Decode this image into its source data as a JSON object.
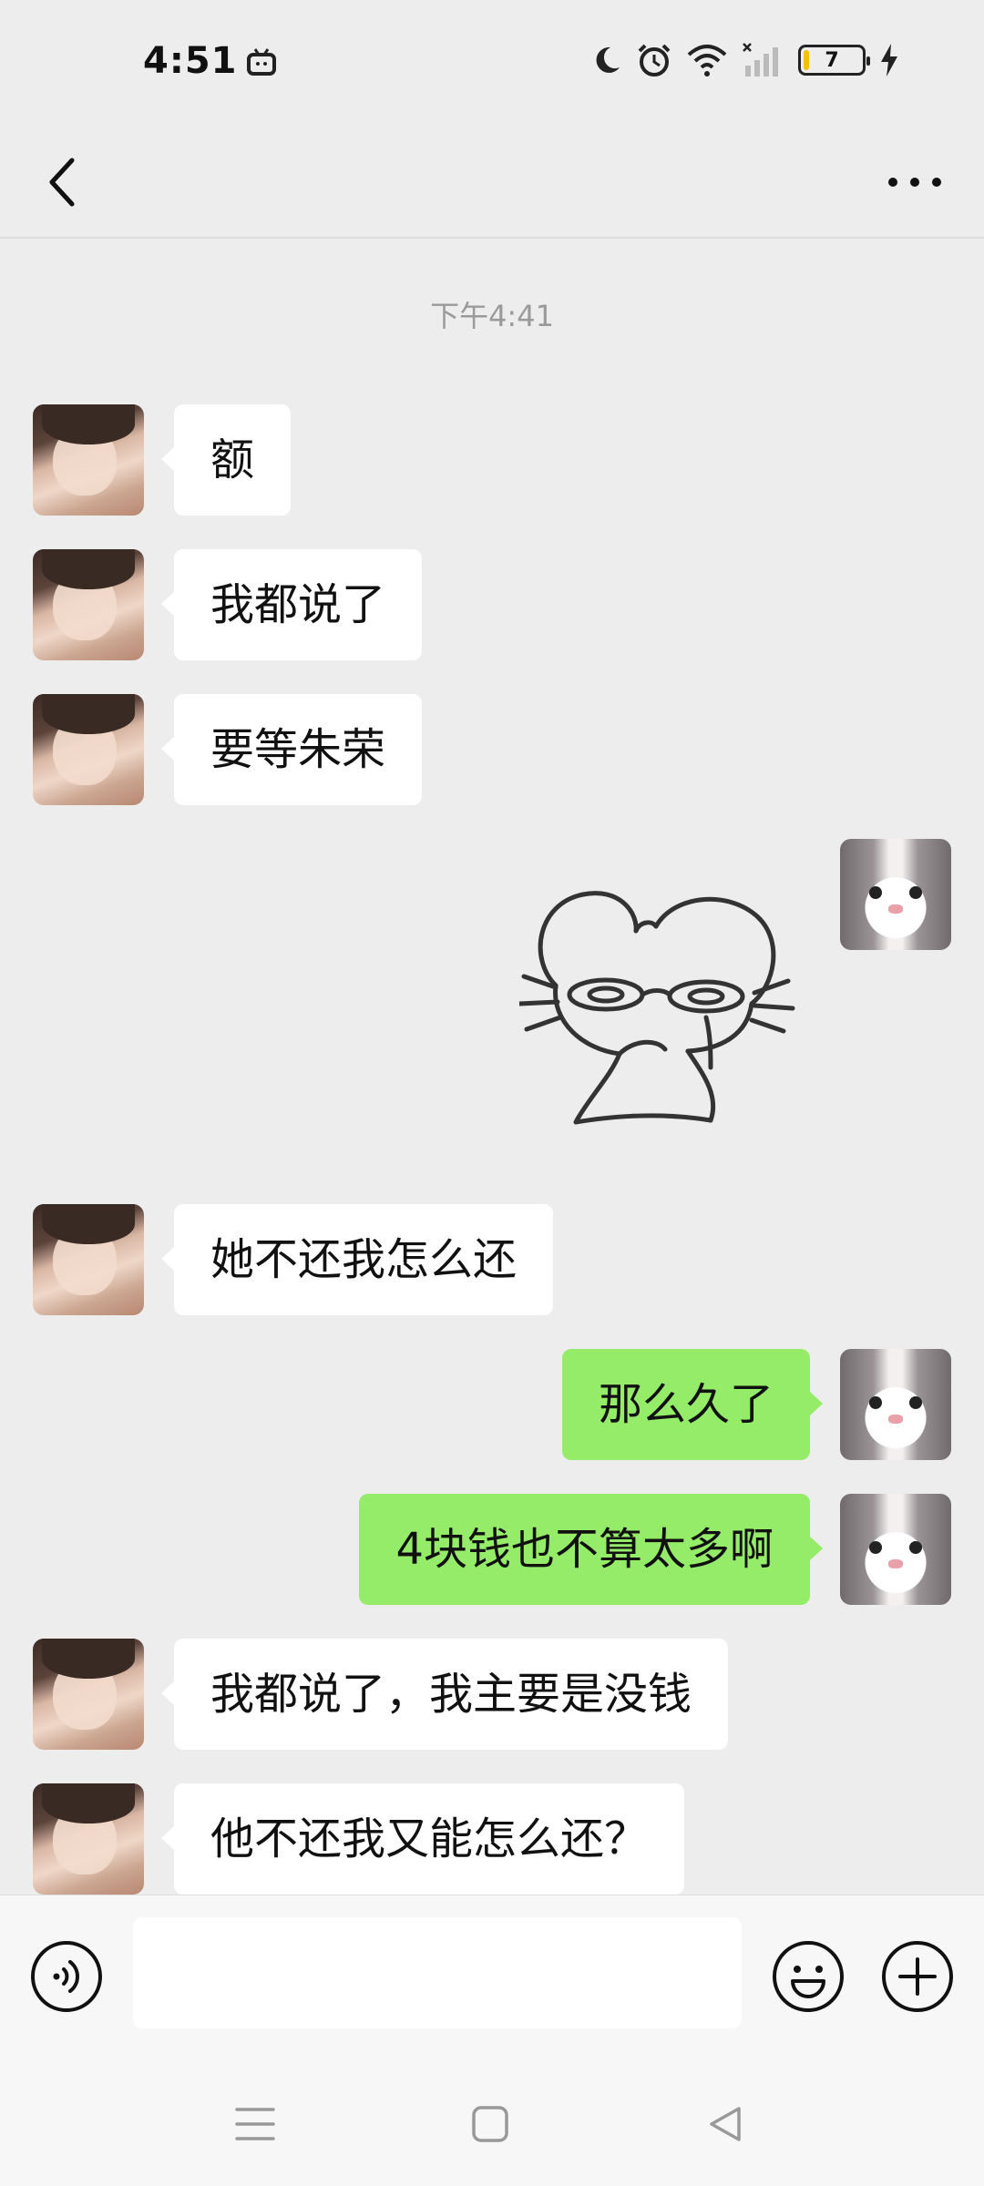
{
  "status_bar": {
    "time": "4:51",
    "battery": "7"
  },
  "chat": {
    "timestamp": "下午4:41",
    "messages": [
      {
        "side": "left",
        "text": "额"
      },
      {
        "side": "left",
        "text": "我都说了"
      },
      {
        "side": "left",
        "text": "要等朱荣"
      },
      {
        "side": "right",
        "sticker": "mouse-sticker"
      },
      {
        "side": "left",
        "text": "她不还我怎么还"
      },
      {
        "side": "right",
        "text": "那么久了"
      },
      {
        "side": "right",
        "text": "4块钱也不算太多啊"
      },
      {
        "side": "left",
        "text": "我都说了，我主要是没钱"
      },
      {
        "side": "left",
        "text": "他不还我又能怎么还？"
      }
    ]
  },
  "input": {
    "placeholder": ""
  },
  "colors": {
    "background": "#ededed",
    "sent_bubble": "#95ec69",
    "received_bubble": "#ffffff"
  }
}
